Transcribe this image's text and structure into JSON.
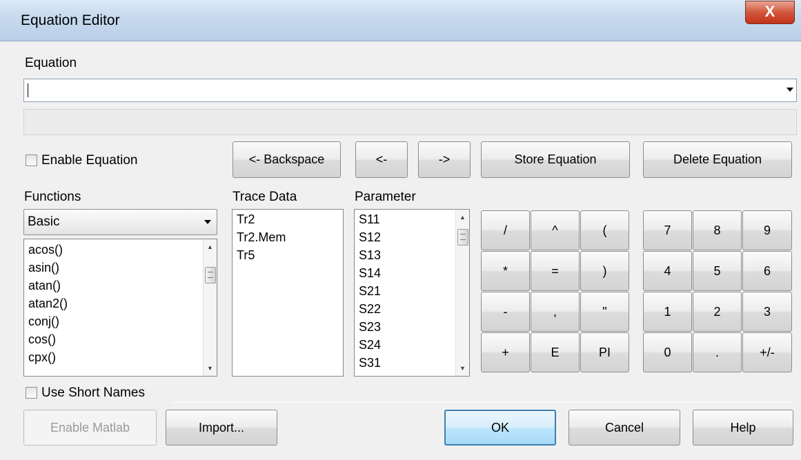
{
  "window": {
    "title": "Equation Editor",
    "close_glyph": "X"
  },
  "equation": {
    "label": "Equation",
    "value": "",
    "status": ""
  },
  "enable_equation": {
    "label": "Enable Equation",
    "checked": false
  },
  "edit_buttons": {
    "backspace": "<- Backspace",
    "left": "<-",
    "right": "->",
    "store": "Store Equation",
    "delete": "Delete Equation"
  },
  "functions": {
    "label": "Functions",
    "category": "Basic",
    "items": [
      "acos()",
      "asin()",
      "atan()",
      "atan2()",
      "conj()",
      "cos()",
      "cpx()"
    ]
  },
  "trace_data": {
    "label": "Trace Data",
    "items": [
      "Tr2",
      "Tr2.Mem",
      "Tr5"
    ]
  },
  "parameter": {
    "label": "Parameter",
    "items": [
      "S11",
      "S12",
      "S13",
      "S14",
      "S21",
      "S22",
      "S23",
      "S24",
      "S31"
    ]
  },
  "operator_keys": [
    "/",
    "^",
    "(",
    "*",
    "=",
    ")",
    "-",
    ",",
    "\"",
    "+",
    "E",
    "PI"
  ],
  "number_keys": [
    "7",
    "8",
    "9",
    "4",
    "5",
    "6",
    "1",
    "2",
    "3",
    "0",
    ".",
    "+/-"
  ],
  "use_short_names": {
    "label": "Use Short Names",
    "checked": false
  },
  "footer": {
    "enable_matlab": "Enable Matlab",
    "import": "Import...",
    "ok": "OK",
    "cancel": "Cancel",
    "help": "Help"
  }
}
